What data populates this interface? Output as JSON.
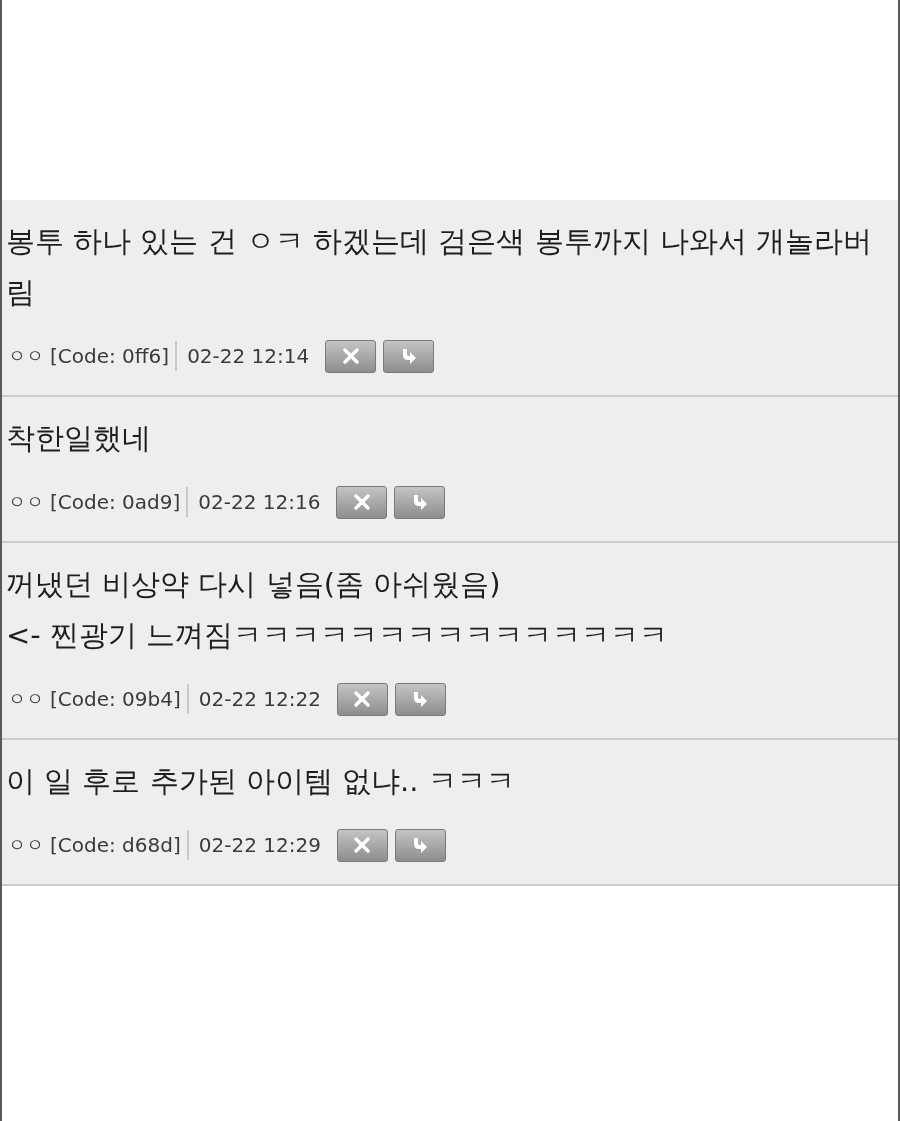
{
  "comments": [
    {
      "text": "봉투 하나 있는 건 ㅇㅋ 하겠는데 검은색 봉투까지 나와서 개놀라버림",
      "author": "ㅇㅇ",
      "code": "[Code: 0ff6]",
      "time": "02-22 12:14"
    },
    {
      "text": "착한일했네",
      "author": "ㅇㅇ",
      "code": "[Code: 0ad9]",
      "time": "02-22 12:16"
    },
    {
      "text": "꺼냈던 비상약 다시 넣음(좀 아쉬웠음)\n<- 찐광기 느껴짐ㅋㅋㅋㅋㅋㅋㅋㅋㅋㅋㅋㅋㅋㅋㅋ",
      "author": "ㅇㅇ",
      "code": "[Code: 09b4]",
      "time": "02-22 12:22"
    },
    {
      "text": "이 일 후로 추가된 아이템 없냐.. ㅋㅋㅋ",
      "author": "ㅇㅇ",
      "code": "[Code: d68d]",
      "time": "02-22 12:29"
    }
  ]
}
